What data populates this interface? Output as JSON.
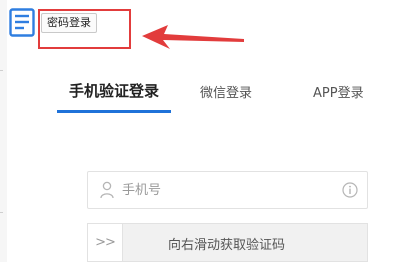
{
  "header": {
    "menu_icon": "list-icon",
    "password_login_label": "密码登录"
  },
  "tabs": [
    {
      "label": "手机验证登录",
      "active": true
    },
    {
      "label": "微信登录",
      "active": false
    },
    {
      "label": "APP登录",
      "active": false
    }
  ],
  "phone_field": {
    "placeholder": "手机号",
    "value": "",
    "icon": "user-icon",
    "info_icon": "info-icon"
  },
  "slider": {
    "handle_glyph": ">>",
    "label": "向右滑动获取验证码"
  },
  "colors": {
    "accent": "#1f72d9",
    "highlight": "#e23c3c",
    "icon_blue": "#2f7ee0"
  }
}
